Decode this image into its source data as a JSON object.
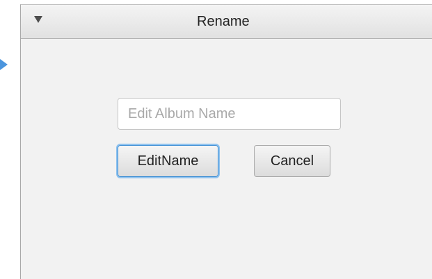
{
  "dialog": {
    "title": "Rename",
    "collapse_icon": "collapse-triangle-icon",
    "input": {
      "value": "",
      "placeholder": "Edit Album Name"
    },
    "buttons": {
      "edit_label": "EditName",
      "cancel_label": "Cancel"
    }
  },
  "colors": {
    "focus_accent": "#3b8dd5",
    "pointer_arrow": "#4b95dd",
    "background": "#f2f2f2"
  }
}
